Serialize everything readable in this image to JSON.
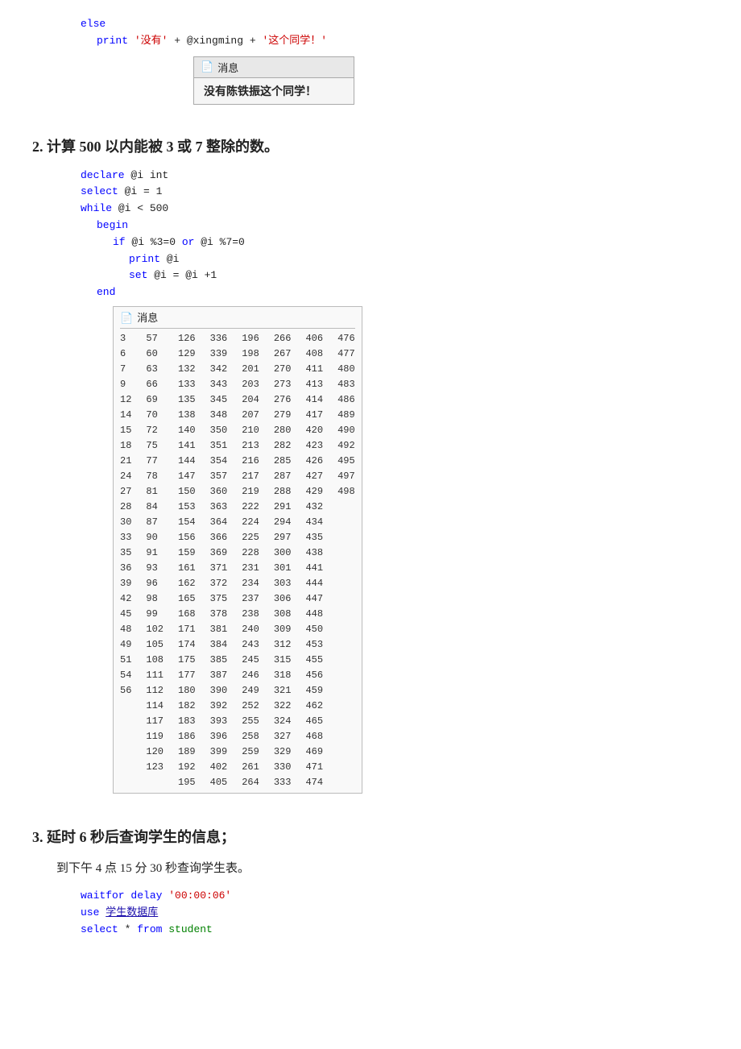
{
  "section1": {
    "else_label": "else",
    "print_line": "print '没有' + @xingming + '这个同学！'",
    "message_title": "消息",
    "message_content": "没有陈铁振这个同学！"
  },
  "section2": {
    "title": "2. 计算 500 以内能被 3 或 7 整除的数。",
    "line1": "declare @i int",
    "line2": "select @i = 1",
    "line3": "while @i < 500",
    "line4": "begin",
    "line5": "if @i %3=0 or @i %7=0",
    "line6": "print @i",
    "line7": "set @i = @i +1",
    "line8": "end",
    "result_title": "消息",
    "numbers": {
      "col1": [
        "3",
        "6",
        "7",
        "9",
        "12",
        "14",
        "15",
        "18",
        "21",
        "24",
        "27",
        "28",
        "30",
        "33",
        "35",
        "36",
        "39",
        "42",
        "45",
        "48",
        "49",
        "51",
        "54",
        "56"
      ],
      "col2": [
        "57",
        "60",
        "63",
        "66",
        "69",
        "70",
        "72",
        "75",
        "77",
        "78",
        "81",
        "84",
        "87",
        "90",
        "91",
        "93",
        "96",
        "98",
        "99",
        "102",
        "105",
        "108",
        "111",
        "112",
        "114",
        "117",
        "119",
        "120",
        "123"
      ],
      "col3": [
        "126",
        "129",
        "132",
        "133",
        "135",
        "138",
        "140",
        "141",
        "144",
        "147",
        "150",
        "153",
        "154",
        "156",
        "159",
        "161",
        "162",
        "165",
        "168",
        "171",
        "174",
        "175",
        "177",
        "180",
        "182",
        "183",
        "186",
        "189",
        "192",
        "195"
      ],
      "col4": [
        "336",
        "339",
        "342",
        "343",
        "345",
        "348",
        "350",
        "351",
        "354",
        "357",
        "360",
        "363",
        "364",
        "366",
        "369",
        "371",
        "372",
        "375",
        "378",
        "381",
        "384",
        "385",
        "387",
        "390",
        "392",
        "393",
        "396",
        "399",
        "402",
        "405"
      ],
      "col5": [
        "196",
        "198",
        "201",
        "203",
        "204",
        "207",
        "210",
        "213",
        "216",
        "217",
        "219",
        "222",
        "224",
        "225",
        "228",
        "231",
        "234",
        "237",
        "238",
        "240",
        "243",
        "245",
        "246",
        "249",
        "252",
        "255",
        "258",
        "259",
        "261",
        "264"
      ],
      "col6": [
        "266",
        "267",
        "270",
        "273",
        "276",
        "279",
        "280",
        "282",
        "285",
        "287",
        "288",
        "291",
        "294",
        "297",
        "300",
        "301",
        "303",
        "306",
        "308",
        "309",
        "312",
        "315",
        "318",
        "321",
        "322",
        "324",
        "327",
        "329",
        "330",
        "333"
      ],
      "col7": [
        "406",
        "408",
        "411",
        "413",
        "414",
        "417",
        "420",
        "423",
        "426",
        "427",
        "429",
        "432",
        "434",
        "435",
        "438",
        "441",
        "444",
        "447",
        "448",
        "450",
        "453",
        "455",
        "456",
        "459",
        "462",
        "465",
        "468",
        "469",
        "471",
        "474"
      ],
      "col8": [
        "476",
        "477",
        "480",
        "483",
        "486",
        "489",
        "490",
        "492",
        "495",
        "497",
        "498"
      ]
    }
  },
  "section3": {
    "title": "3. 延时 6 秒后查询学生的信息；",
    "subtitle": "到下午 4 点 15 分 30 秒查询学生表。",
    "line1": "waitfor delay '00:00:06'",
    "line2": "use  学生数据库",
    "line3": "select * from student"
  },
  "icons": {
    "message": "🗒",
    "doc": "📄"
  }
}
